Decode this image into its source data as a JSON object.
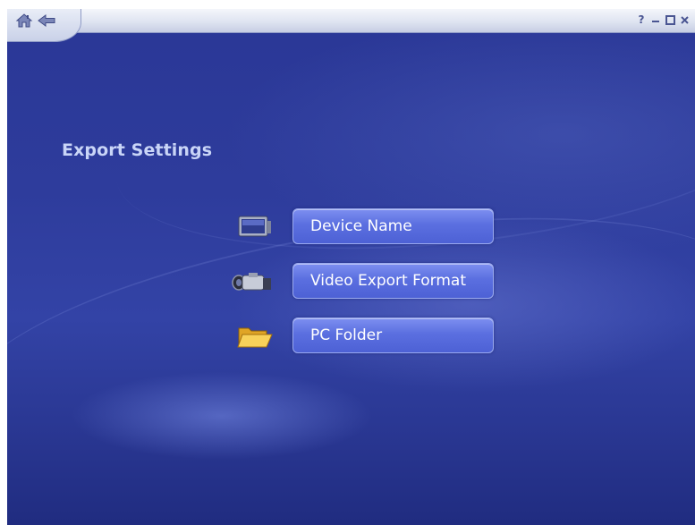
{
  "window": {
    "accent_color": "#5b6fe0",
    "background_color": "#2e3c9c"
  },
  "topbar": {
    "nav": [
      {
        "icon": "home-icon"
      },
      {
        "icon": "back-arrow-icon"
      }
    ],
    "controls": [
      {
        "icon": "help-icon",
        "label": "?"
      },
      {
        "icon": "minimize-icon"
      },
      {
        "icon": "maximize-icon"
      },
      {
        "icon": "close-icon"
      }
    ]
  },
  "page": {
    "title": "Export Settings"
  },
  "menu": {
    "items": [
      {
        "label": "Device Name",
        "icon": "monitor-device-icon"
      },
      {
        "label": "Video Export Format",
        "icon": "camcorder-icon"
      },
      {
        "label": "PC Folder",
        "icon": "folder-icon"
      }
    ]
  }
}
